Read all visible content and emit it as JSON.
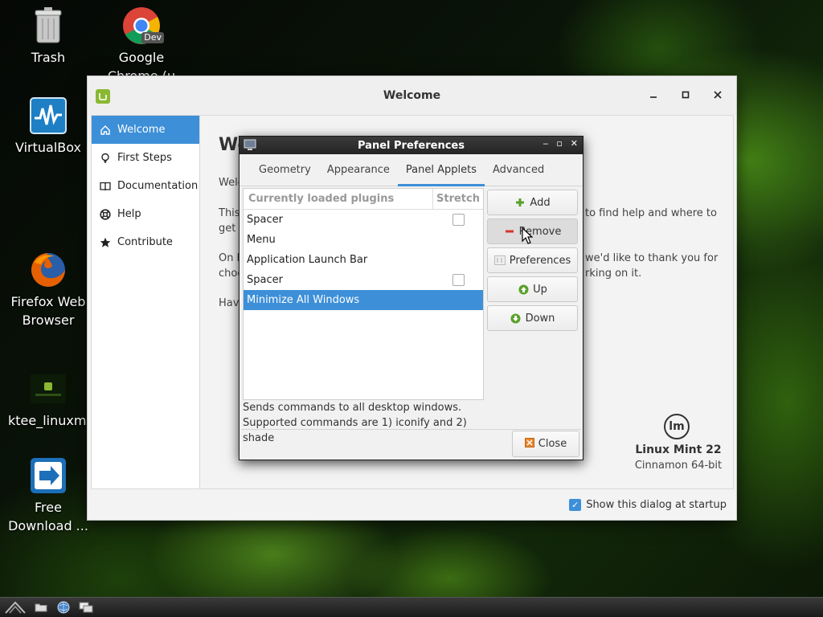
{
  "desktop": {
    "icons": [
      {
        "label": "Trash",
        "icon": "trash-icon"
      },
      {
        "label": "Google Chrome (u",
        "icon": "chrome-dev-icon",
        "badge": "Dev"
      },
      {
        "label": "VirtualBox",
        "icon": "virtualbox-icon"
      },
      {
        "label": "Firefox Web Browser",
        "icon": "firefox-icon"
      },
      {
        "label": "ktee_linuxmint.png",
        "icon": "image-file-icon"
      },
      {
        "label": "Free Download ...",
        "icon": "download-manager-icon"
      }
    ]
  },
  "welcome": {
    "title": "Welcome",
    "sidebar": [
      {
        "label": "Welcome",
        "icon": "home-icon",
        "active": true
      },
      {
        "label": "First Steps",
        "icon": "lightbulb-icon"
      },
      {
        "label": "Documentation",
        "icon": "book-icon"
      },
      {
        "label": "Help",
        "icon": "lifebuoy-icon"
      },
      {
        "label": "Contribute",
        "icon": "star-icon"
      }
    ],
    "content": {
      "heading": "We",
      "p1_left": "Welc",
      "p2_left": "This",
      "p2_left_b": "get",
      "p2_right": "to find help and where to",
      "p3_left": "On b",
      "p3_left_b": "choc",
      "p3_right": "we'd like to thank you for",
      "p3_right_b": "rking on it.",
      "p4_left": "Hav"
    },
    "logo_text": "lm",
    "distro_name": "Linux Mint 22",
    "edition": "Cinnamon 64-bit",
    "startup_checkbox_label": "Show this dialog at startup",
    "startup_checked": true
  },
  "prefs": {
    "title": "Panel Preferences",
    "tabs": [
      "Geometry",
      "Appearance",
      "Panel Applets",
      "Advanced"
    ],
    "active_tab": "Panel Applets",
    "list_header": {
      "plugins": "Currently loaded plugins",
      "stretch": "Stretch"
    },
    "plugins": [
      {
        "name": "Spacer",
        "stretch_checkbox": true,
        "selected": false
      },
      {
        "name": "Menu",
        "stretch_checkbox": false,
        "selected": false
      },
      {
        "name": "Application Launch Bar",
        "stretch_checkbox": false,
        "selected": false
      },
      {
        "name": "Spacer",
        "stretch_checkbox": true,
        "selected": false
      },
      {
        "name": "Minimize All Windows",
        "stretch_checkbox": false,
        "selected": true
      }
    ],
    "buttons": {
      "add": "Add",
      "remove": "Remove",
      "preferences": "Preferences",
      "up": "Up",
      "down": "Down",
      "close": "Close"
    },
    "description_line1": "Sends commands to all desktop windows.",
    "description_line2": "Supported commands are 1) iconify and 2) shade"
  },
  "colors": {
    "accent": "#3d8fd8",
    "mint_green": "#8ab833",
    "add_green": "#5aa02c",
    "remove_red": "#d9352b"
  }
}
